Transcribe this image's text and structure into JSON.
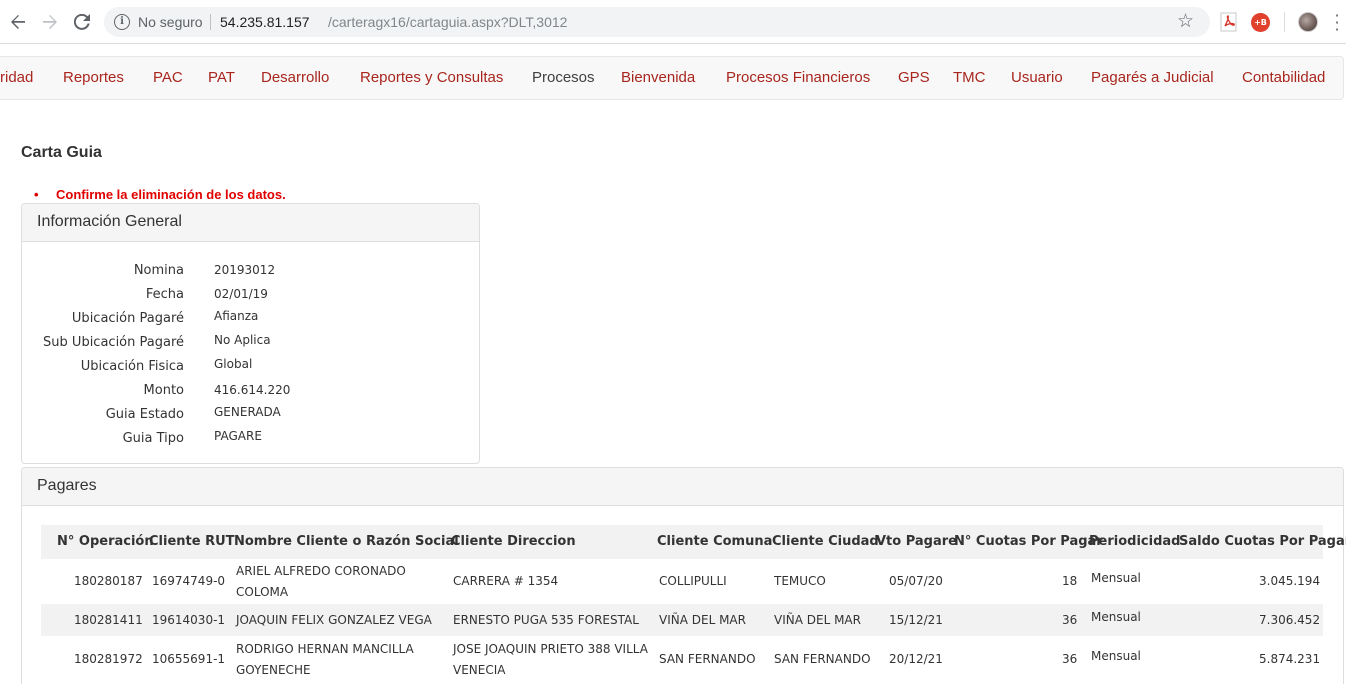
{
  "browser": {
    "security_label": "No seguro",
    "url_host": "54.235.81.157",
    "url_path": "/carteragx16/cartaguia.aspx?DLT,3012"
  },
  "nav": {
    "items": [
      {
        "label": "ridad",
        "color": "#a8261e"
      },
      {
        "label": "Reportes",
        "color": "#a8261e"
      },
      {
        "label": "PAC",
        "color": "#a8261e"
      },
      {
        "label": "PAT",
        "color": "#a8261e"
      },
      {
        "label": "Desarrollo",
        "color": "#a8261e"
      },
      {
        "label": "Reportes y Consultas",
        "color": "#a8261e"
      },
      {
        "label": "Procesos",
        "color": "#404040"
      },
      {
        "label": "Bienvenida",
        "color": "#a8261e"
      },
      {
        "label": "Procesos Financieros",
        "color": "#a8261e"
      },
      {
        "label": "GPS",
        "color": "#a8261e"
      },
      {
        "label": "TMC",
        "color": "#a8261e"
      },
      {
        "label": "Usuario",
        "color": "#a8261e"
      },
      {
        "label": "Pagarés a Judicial",
        "color": "#a8261e"
      },
      {
        "label": "Contabilidad",
        "color": "#a8261e"
      }
    ]
  },
  "page": {
    "title": "Carta Guia",
    "error_message": "Confirme la eliminación de los datos."
  },
  "info_panel": {
    "title": "Información General",
    "fields": [
      {
        "label": "Nomina",
        "value": "20193012"
      },
      {
        "label": "Fecha",
        "value": "02/01/19"
      },
      {
        "label": "Ubicación Pagaré",
        "value": "Afianza"
      },
      {
        "label": "Sub Ubicación Pagaré",
        "value": "No Aplica"
      },
      {
        "label": "Ubicación Fisica",
        "value": "Global"
      },
      {
        "label": "Monto",
        "value": "416.614.220"
      },
      {
        "label": "Guia Estado",
        "value": "GENERADA"
      },
      {
        "label": "Guia Tipo",
        "value": "PAGARE"
      }
    ]
  },
  "pagares_panel": {
    "title": "Pagares",
    "columns": [
      "N° Operación",
      "Cliente RUT",
      "Nombre Cliente o Razón Social",
      "Cliente Direccion",
      "Cliente Comuna",
      "Cliente Ciudad",
      "Vto Pagare",
      "N° Cuotas Por Pagar",
      "Periodicidad",
      "Saldo Cuotas Por Pagar"
    ],
    "rows": [
      [
        "180280187",
        "16974749-0",
        "ARIEL ALFREDO CORONADO COLOMA",
        "CARRERA # 1354",
        "COLLIPULLI",
        "TEMUCO",
        "05/07/20",
        "18",
        "Mensual",
        "3.045.194"
      ],
      [
        "180281411",
        "19614030-1",
        "JOAQUIN FELIX GONZALEZ VEGA",
        "ERNESTO PUGA 535 FORESTAL",
        "VIÑA DEL MAR",
        "VIÑA DEL MAR",
        "15/12/21",
        "36",
        "Mensual",
        "7.306.452"
      ],
      [
        "180281972",
        "10655691-1",
        "RODRIGO HERNAN MANCILLA GOYENECHE",
        "JOSE JOAQUIN PRIETO 388 VILLA VENECIA",
        "SAN FERNANDO",
        "SAN FERNANDO",
        "20/12/21",
        "36",
        "Mensual",
        "5.874.231"
      ]
    ]
  }
}
